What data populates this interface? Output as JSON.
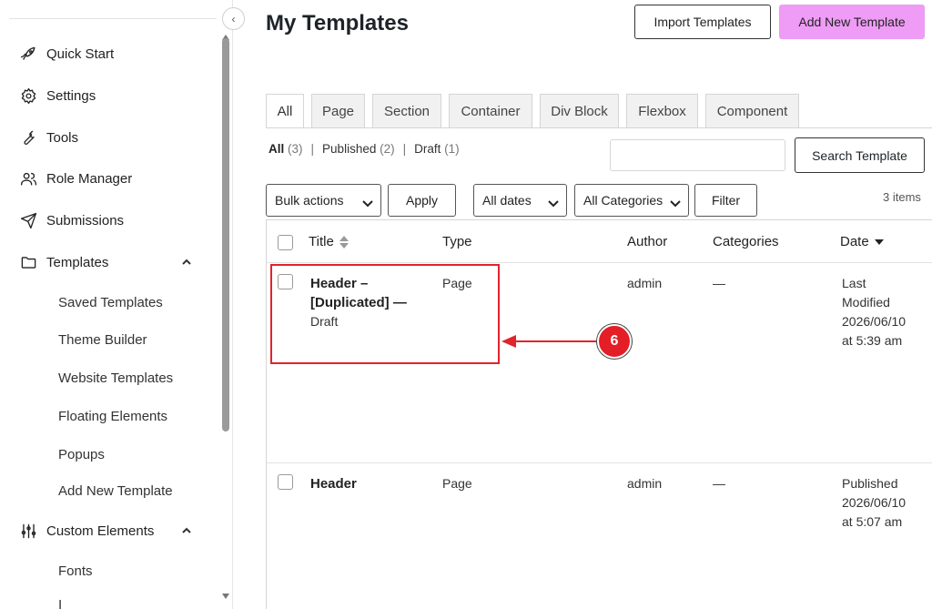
{
  "sidebar": {
    "items": [
      {
        "label": "Quick Start",
        "icon": "rocket-icon"
      },
      {
        "label": "Settings",
        "icon": "gear-icon"
      },
      {
        "label": "Tools",
        "icon": "wrench-icon"
      },
      {
        "label": "Role Manager",
        "icon": "users-icon"
      },
      {
        "label": "Submissions",
        "icon": "send-icon"
      },
      {
        "label": "Templates",
        "icon": "folder-icon"
      },
      {
        "label": "Custom Elements",
        "icon": "sliders-icon"
      }
    ],
    "template_subitems": [
      "Saved Templates",
      "Theme Builder",
      "Website Templates",
      "Floating Elements",
      "Popups",
      "Add New Template"
    ],
    "custom_elements_subitems": [
      "Fonts",
      "I"
    ]
  },
  "header": {
    "title": "My Templates",
    "import_label": "Import Templates",
    "add_label": "Add New Template",
    "add_color": "#ef9cf6"
  },
  "tabs": [
    "All",
    "Page",
    "Section",
    "Container",
    "Div Block",
    "Flexbox",
    "Component"
  ],
  "status_filters": {
    "all": {
      "label": "All",
      "count": "(3)"
    },
    "published": {
      "label": "Published",
      "count": "(2)"
    },
    "draft": {
      "label": "Draft",
      "count": "(1)"
    },
    "separator": "|"
  },
  "search": {
    "placeholder": "",
    "button_label": "Search Template"
  },
  "toolbar": {
    "bulk_actions": "Bulk actions",
    "apply": "Apply",
    "all_dates": "All dates",
    "all_categories": "All Categories",
    "filter": "Filter",
    "items_count": "3 items"
  },
  "table": {
    "columns": [
      "Title",
      "Type",
      "Author",
      "Categories",
      "Date"
    ],
    "rows": [
      {
        "title": "Header –",
        "title_line2": "[Duplicated] —",
        "status": "Draft",
        "type": "Page",
        "author": "admin",
        "categories": "—",
        "date_label": "Last",
        "date_label2": "Modified",
        "date": "2026/06/10",
        "time": "at 5:39 am"
      },
      {
        "title": "Header",
        "type": "Page",
        "author": "admin",
        "categories": "—",
        "date_label": "Published",
        "date": "2026/06/10",
        "time": "at 5:07 am"
      }
    ]
  },
  "annotation": {
    "step": "6",
    "color": "#e0242b"
  }
}
